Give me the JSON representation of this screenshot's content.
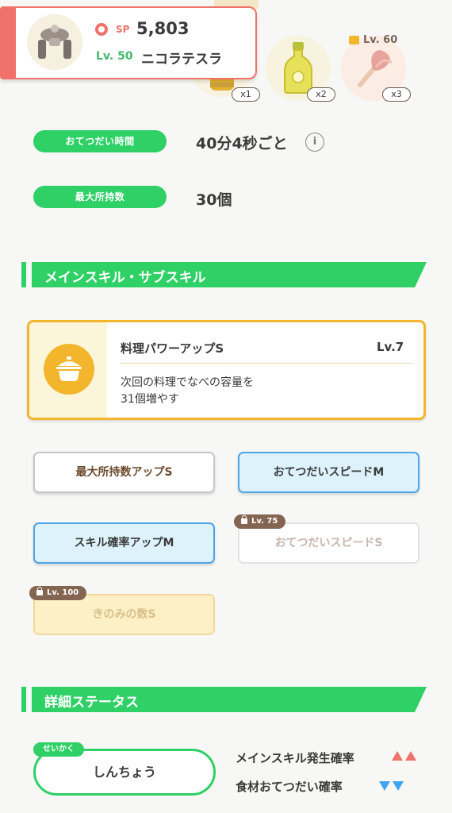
{
  "header": {
    "sp_label": "SP",
    "sp_value": "5,803",
    "level_label": "Lv. 50",
    "pokemon_name": "ニコラテスラ"
  },
  "ingredients": [
    {
      "icon": "honey-jar-icon",
      "count": "x1"
    },
    {
      "icon": "oil-bottle-icon",
      "count": "x2"
    },
    {
      "icon": "leek-icon",
      "count": "x3",
      "lock_level": "Lv. 60"
    }
  ],
  "stats": {
    "help_time_label": "おてつだい時間",
    "help_time_value": "40分4秒ごと",
    "info_glyph": "i",
    "max_carry_label": "最大所持数",
    "max_carry_value": "30個"
  },
  "skills_section": {
    "title": "メインスキル・サブスキル"
  },
  "main_skill": {
    "icon": "cooking-pot-icon",
    "name": "料理パワーアップS",
    "level": "Lv.7",
    "description_line1": "次回の料理でなべの容量を",
    "description_line2": "31個増やす"
  },
  "sub_skills": [
    {
      "label": "最大所持数アップS",
      "style": "white",
      "lock": ""
    },
    {
      "label": "おてつだいスピードM",
      "style": "blue",
      "lock": ""
    },
    {
      "label": "スキル確率アップM",
      "style": "blue",
      "lock": ""
    },
    {
      "label": "おてつだいスピードS",
      "style": "locked",
      "lock": "Lv. 75"
    },
    {
      "label": "きのみの数S",
      "style": "gold",
      "lock": "Lv. 100"
    }
  ],
  "details_section": {
    "title": "詳細ステータス"
  },
  "nature": {
    "tag": "せいかく",
    "value": "しんちょう",
    "up_effect": "メインスキル発生確率",
    "down_effect": "食材おてつだい確率"
  },
  "colors": {
    "accent_green": "#2fd066",
    "header_red": "#f0726a",
    "skill_gold": "#f2b52c",
    "sub_blue": "#4ea6e8",
    "up_red": "#f0726a",
    "down_blue": "#3fa4f0"
  }
}
